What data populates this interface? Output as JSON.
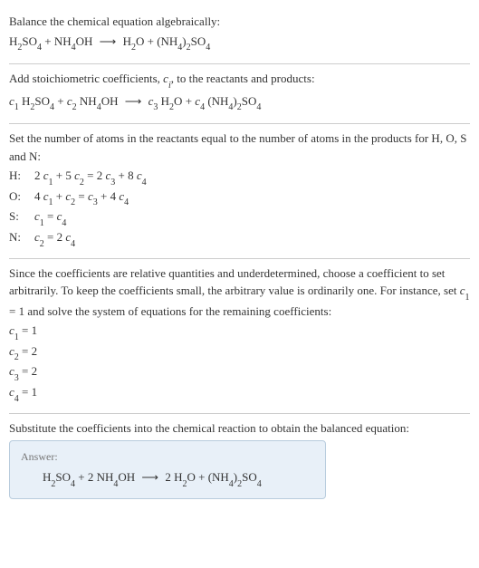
{
  "intro": {
    "line1": "Balance the chemical equation algebraically:",
    "eq": {
      "r1a": "H",
      "r1b": "2",
      "r1c": "SO",
      "r1d": "4",
      "plus1": " + ",
      "r2a": "NH",
      "r2b": "4",
      "r2c": "OH",
      "arrow": "⟶",
      "p1a": "H",
      "p1b": "2",
      "p1c": "O",
      "plus2": " + ",
      "p2a": "(NH",
      "p2b": "4",
      "p2c": ")",
      "p2d": "2",
      "p2e": "SO",
      "p2f": "4"
    }
  },
  "stoich": {
    "text_a": "Add stoichiometric coefficients, ",
    "text_ci": "c",
    "text_ci_sub": "i",
    "text_b": ", to the reactants and products:",
    "eq": {
      "c1": "c",
      "c1s": "1",
      "sp1": " ",
      "r1a": "H",
      "r1b": "2",
      "r1c": "SO",
      "r1d": "4",
      "plus1": " + ",
      "c2": "c",
      "c2s": "2",
      "sp2": " ",
      "r2a": "NH",
      "r2b": "4",
      "r2c": "OH",
      "arrow": "⟶",
      "c3": "c",
      "c3s": "3",
      "sp3": " ",
      "p1a": "H",
      "p1b": "2",
      "p1c": "O",
      "plus2": " + ",
      "c4": "c",
      "c4s": "4",
      "sp4": " ",
      "p2a": "(NH",
      "p2b": "4",
      "p2c": ")",
      "p2d": "2",
      "p2e": "SO",
      "p2f": "4"
    }
  },
  "atoms": {
    "text": "Set the number of atoms in the reactants equal to the number of atoms in the products for H, O, S and N:",
    "rows": {
      "H": {
        "label": "H:",
        "lhs_a": "2 ",
        "c1": "c",
        "c1s": "1",
        "mid1": " + 5 ",
        "c2": "c",
        "c2s": "2",
        "eq": " = 2 ",
        "c3": "c",
        "c3s": "3",
        "mid2": " + 8 ",
        "c4": "c",
        "c4s": "4"
      },
      "O": {
        "label": "O:",
        "lhs_a": "4 ",
        "c1": "c",
        "c1s": "1",
        "mid1": " + ",
        "c2": "c",
        "c2s": "2",
        "eq": " = ",
        "c3": "c",
        "c3s": "3",
        "mid2": " + 4 ",
        "c4": "c",
        "c4s": "4"
      },
      "S": {
        "label": " S:",
        "c1": "c",
        "c1s": "1",
        "eq": " = ",
        "c4": "c",
        "c4s": "4"
      },
      "N": {
        "label": "N:",
        "c2": "c",
        "c2s": "2",
        "eq": " = 2 ",
        "c4": "c",
        "c4s": "4"
      }
    }
  },
  "solve": {
    "text_a": "Since the coefficients are relative quantities and underdetermined, choose a coefficient to set arbitrarily. To keep the coefficients small, the arbitrary value is ordinarily one. For instance, set ",
    "c1": "c",
    "c1s": "1",
    "text_b": " = 1 and solve the system of equations for the remaining coefficients:",
    "vals": {
      "l1_a": "c",
      "l1_b": "1",
      "l1_c": " = 1",
      "l2_a": "c",
      "l2_b": "2",
      "l2_c": " = 2",
      "l3_a": "c",
      "l3_b": "3",
      "l3_c": " = 2",
      "l4_a": "c",
      "l4_b": "4",
      "l4_c": " = 1"
    }
  },
  "final": {
    "text": "Substitute the coefficients into the chemical reaction to obtain the balanced equation:",
    "answer_label": "Answer:",
    "eq": {
      "r1a": "H",
      "r1b": "2",
      "r1c": "SO",
      "r1d": "4",
      "plus1": " + 2 ",
      "r2a": "NH",
      "r2b": "4",
      "r2c": "OH",
      "arrow": "⟶",
      "two": "2 ",
      "p1a": "H",
      "p1b": "2",
      "p1c": "O",
      "plus2": " + ",
      "p2a": "(NH",
      "p2b": "4",
      "p2c": ")",
      "p2d": "2",
      "p2e": "SO",
      "p2f": "4"
    }
  }
}
